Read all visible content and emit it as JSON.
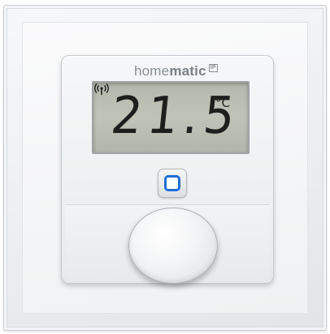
{
  "device": {
    "brand_regular": "home",
    "brand_bold": "matic",
    "brand_badge": "IP",
    "display": {
      "temperature": "21.5",
      "unit": "°C"
    },
    "icons": {
      "signal": "radio-signal-icon",
      "button": "square-button-icon"
    },
    "colors": {
      "button_accent": "#1f6fd6",
      "lcd_background": "#b9bcb1"
    }
  }
}
